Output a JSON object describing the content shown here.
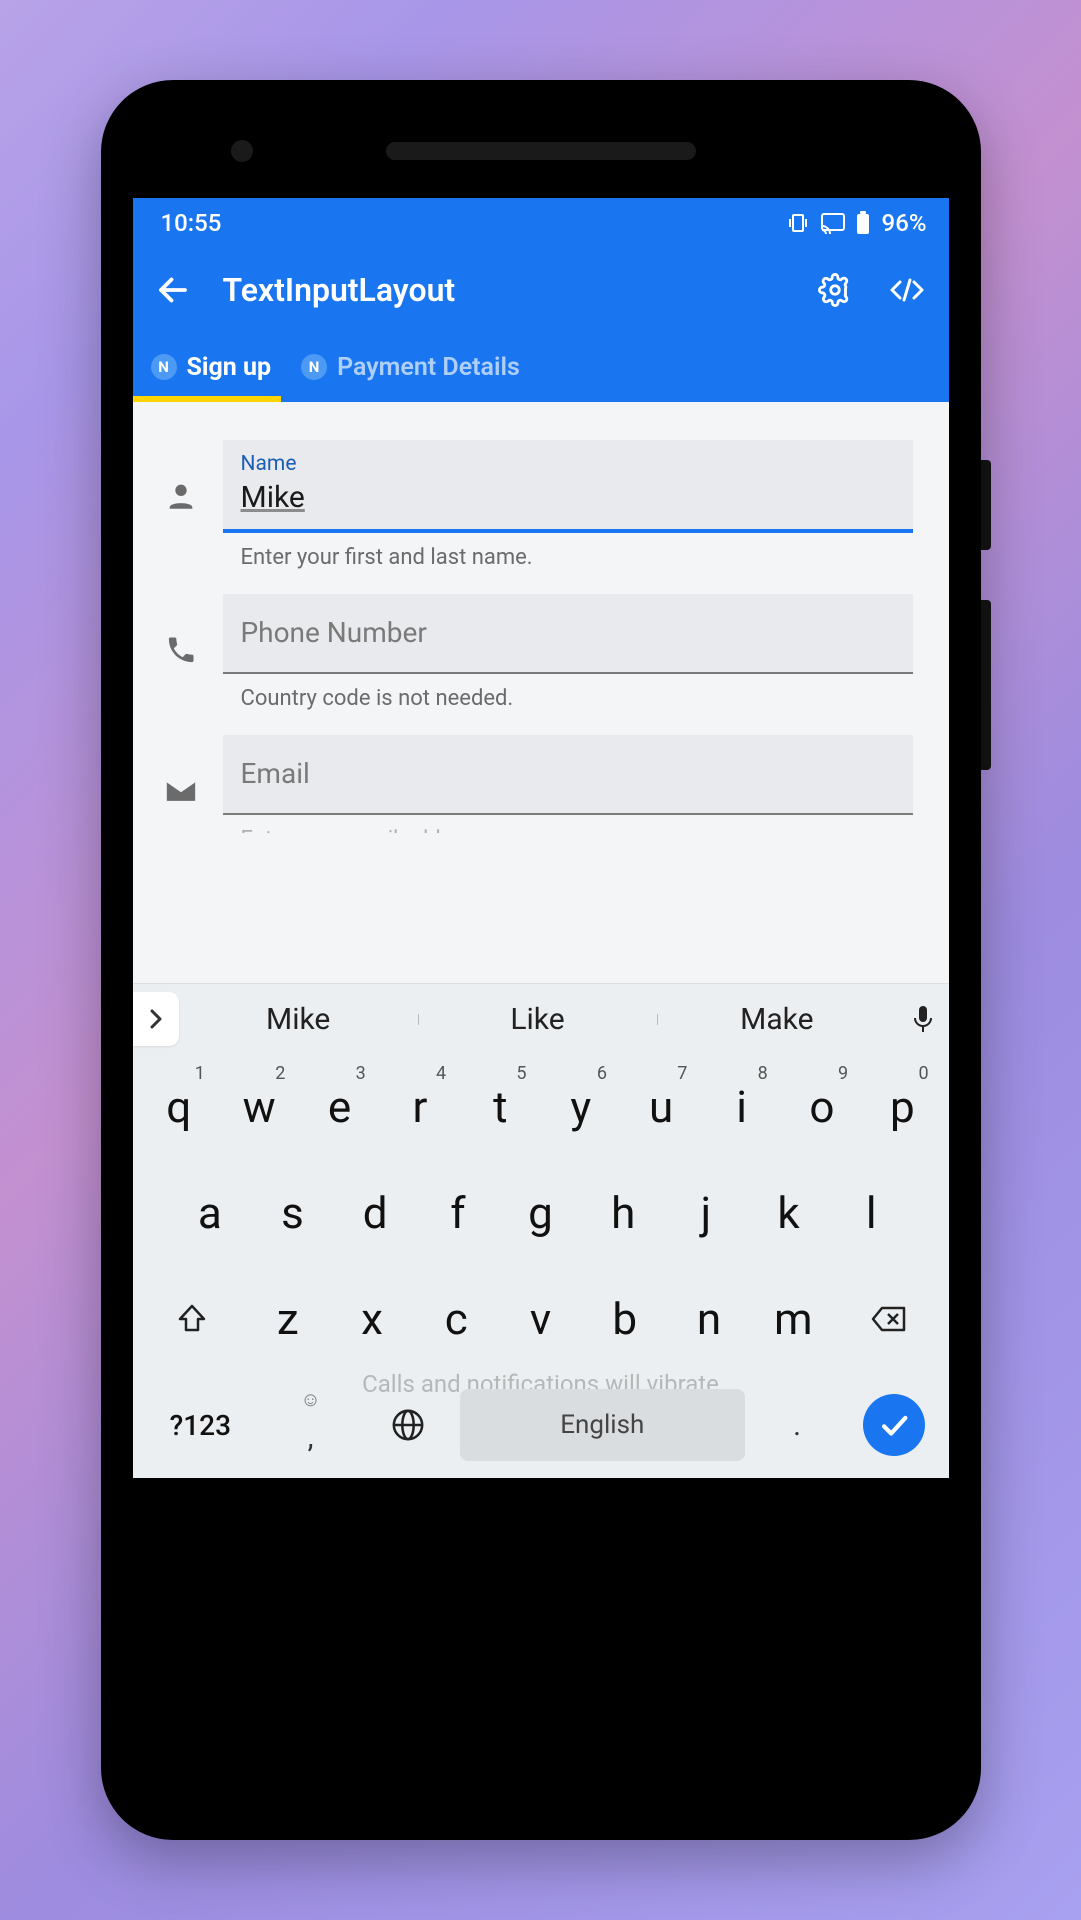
{
  "status": {
    "time": "10:55",
    "battery": "96%"
  },
  "appbar": {
    "title": "TextInputLayout"
  },
  "tabs": [
    {
      "badge": "N",
      "label": "Sign up",
      "active": true
    },
    {
      "badge": "N",
      "label": "Payment Details",
      "active": false
    }
  ],
  "form": {
    "name": {
      "label": "Name",
      "value": "Mike",
      "helper": "Enter your first and last name."
    },
    "phone": {
      "placeholder": "Phone Number",
      "helper": "Country code is not needed."
    },
    "email": {
      "placeholder": "Email",
      "helper": "Enter your email address"
    }
  },
  "keyboard": {
    "suggestions": [
      "Mike",
      "Like",
      "Make"
    ],
    "row1": [
      {
        "k": "q",
        "n": "1"
      },
      {
        "k": "w",
        "n": "2"
      },
      {
        "k": "e",
        "n": "3"
      },
      {
        "k": "r",
        "n": "4"
      },
      {
        "k": "t",
        "n": "5"
      },
      {
        "k": "y",
        "n": "6"
      },
      {
        "k": "u",
        "n": "7"
      },
      {
        "k": "i",
        "n": "8"
      },
      {
        "k": "o",
        "n": "9"
      },
      {
        "k": "p",
        "n": "0"
      }
    ],
    "row2": [
      "a",
      "s",
      "d",
      "f",
      "g",
      "h",
      "j",
      "k",
      "l"
    ],
    "row3": [
      "z",
      "x",
      "c",
      "v",
      "b",
      "n",
      "m"
    ],
    "sym": "?123",
    "space": "English",
    "comma": ",",
    "period": "."
  },
  "toast": "Calls and notifications will vibrate"
}
